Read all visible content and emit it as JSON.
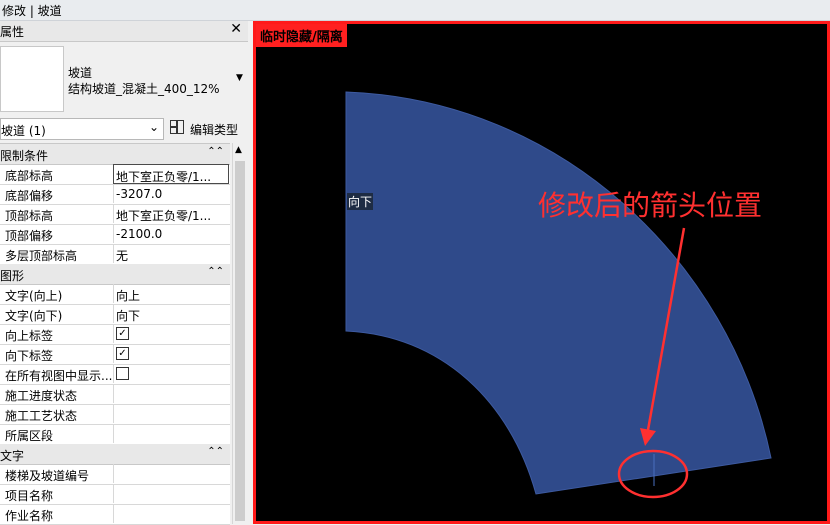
{
  "window": {
    "title": "修改 | 坡道"
  },
  "properties": {
    "header": "属性",
    "close": "✕",
    "type_family": "坡道",
    "type_name": "结构坡道_混凝土_400_12%",
    "instance_selector": "坡道 (1)",
    "edit_type": "编辑类型",
    "categories": {
      "constraints": "限制条件",
      "graphics": "图形",
      "text": "文字"
    },
    "rows": {
      "base_level": {
        "name": "底部标高",
        "value": "地下室正负零/1..."
      },
      "base_offset": {
        "name": "底部偏移",
        "value": "-3207.0"
      },
      "top_level": {
        "name": "顶部标高",
        "value": "地下室正负零/1..."
      },
      "top_offset": {
        "name": "顶部偏移",
        "value": "-2100.0"
      },
      "multistory_top": {
        "name": "多层顶部标高",
        "value": "无"
      },
      "text_up": {
        "name": "文字(向上)",
        "value": "向上"
      },
      "text_down": {
        "name": "文字(向下)",
        "value": "向下"
      },
      "up_label": {
        "name": "向上标签",
        "checked": true
      },
      "down_label": {
        "name": "向下标签",
        "checked": true
      },
      "show_all_views": {
        "name": "在所有视图中显示...",
        "checked": false
      },
      "phase_status": {
        "name": "施工进度状态",
        "value": ""
      },
      "process_status": {
        "name": "施工工艺状态",
        "value": ""
      },
      "zone": {
        "name": "所属区段",
        "value": ""
      },
      "stair_number": {
        "name": "楼梯及坡道编号",
        "value": ""
      },
      "project_name": {
        "name": "项目名称",
        "value": ""
      },
      "job_name": {
        "name": "作业名称",
        "value": ""
      }
    }
  },
  "view": {
    "mode_tag": "临时隐藏/隔离",
    "ramp_label": "向下",
    "annotation": "修改后的箭头位置",
    "colors": {
      "ramp": "#2f4a8a",
      "annotation": "#ff3030",
      "border": "#ff1a1a"
    }
  }
}
